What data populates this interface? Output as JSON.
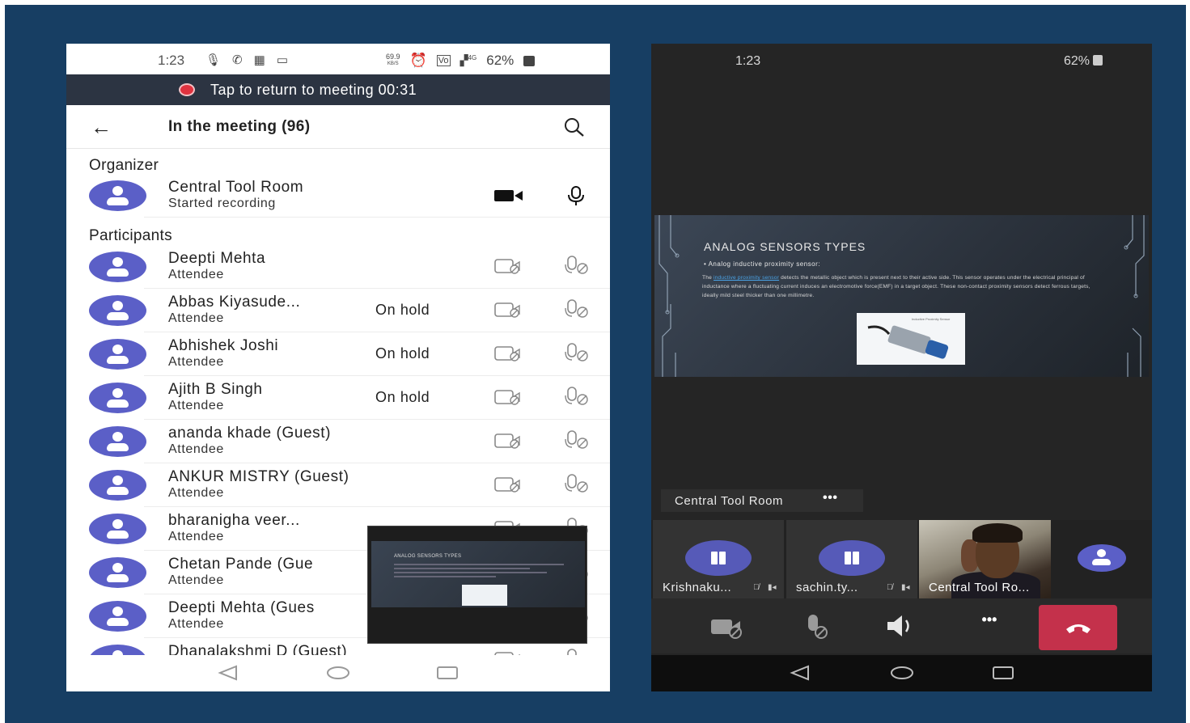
{
  "left_phone": {
    "status_bar": {
      "time": "1:23",
      "speed_top": "69.9",
      "speed_unit": "KB/S",
      "network": "4G",
      "battery": "62%"
    },
    "banner": {
      "text": "Tap to return to meeting 00:31"
    },
    "header": {
      "title": "In the meeting (96)"
    },
    "organizer_heading": "Organizer",
    "organizer": {
      "name": "Central Tool Room",
      "status": "Started recording"
    },
    "participants_heading": "Participants",
    "participants": [
      {
        "name": "Deepti Mehta",
        "role": "Attendee",
        "state": ""
      },
      {
        "name": "Abbas Kiyasude...",
        "role": "Attendee",
        "state": "On hold"
      },
      {
        "name": "Abhishek Joshi",
        "role": "Attendee",
        "state": "On hold"
      },
      {
        "name": "Ajith B Singh",
        "role": "Attendee",
        "state": "On hold"
      },
      {
        "name": "ananda khade (Guest)",
        "role": "Attendee",
        "state": ""
      },
      {
        "name": "ANKUR MISTRY (Guest)",
        "role": "Attendee",
        "state": ""
      },
      {
        "name": "bharanigha veer...",
        "role": "Attendee",
        "state": ""
      },
      {
        "name": "Chetan Pande (Gue",
        "role": "Attendee",
        "state": ""
      },
      {
        "name": "Deepti Mehta (Gues",
        "role": "Attendee",
        "state": ""
      },
      {
        "name": "Dhanalakshmi D (Guest)",
        "role": "",
        "state": ""
      }
    ],
    "pip_slide_title": "ANALOG SENSORS TYPES"
  },
  "right_phone": {
    "status_bar": {
      "time": "1:23",
      "battery": "62%"
    },
    "slide": {
      "title": "ANALOG SENSORS TYPES",
      "bullet": "• Analog inductive proximity sensor:",
      "para_start": "The ",
      "para_link": "inductive proximity sensor",
      "para_rest": " detects the metallic object which is present next to their active side. This sensor operates under the electrical principal of inductance where a fluctuating current induces an electromotive force(EMF) in a target object. These non-contact proximity sensors detect ferrous targets, ideally mild steel thicker than one millimetre.",
      "image_caption": "Inductive Proximity Sensor"
    },
    "presenter_label": "Central Tool Room",
    "presenter_more": "•••",
    "tiles": [
      {
        "label": "Krishnaku..."
      },
      {
        "label": "sachin.ty..."
      },
      {
        "label": "Central Tool Ro..."
      }
    ],
    "controls": {
      "more_label": "•••"
    }
  }
}
